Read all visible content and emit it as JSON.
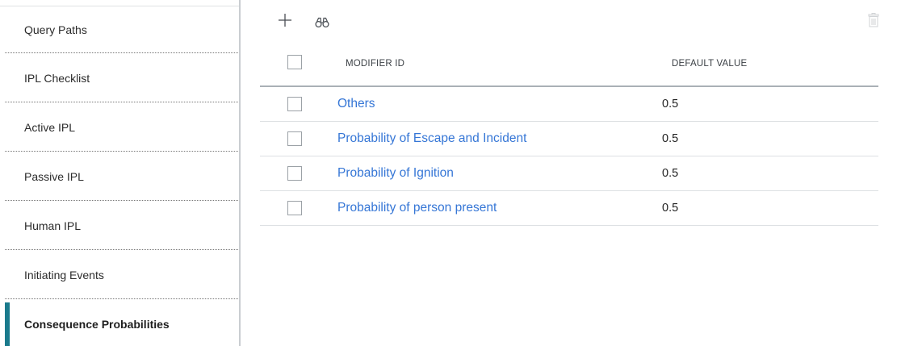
{
  "sidebar": {
    "items": [
      {
        "label": "Query Paths",
        "active": false
      },
      {
        "label": "IPL Checklist",
        "active": false
      },
      {
        "label": "Active IPL",
        "active": false
      },
      {
        "label": "Passive IPL",
        "active": false
      },
      {
        "label": "Human IPL",
        "active": false
      },
      {
        "label": "Initiating Events",
        "active": false
      },
      {
        "label": "Consequence Probabilities",
        "active": true
      }
    ],
    "accent_color": "#1a7a8c"
  },
  "toolbar": {
    "add_icon": "plus-icon",
    "find_icon": "binoculars-icon",
    "delete_icon": "trash-icon"
  },
  "grid": {
    "columns": [
      "MODIFIER ID",
      "DEFAULT VALUE"
    ],
    "rows": [
      {
        "modifier_id": "Others",
        "default_value": "0.5"
      },
      {
        "modifier_id": "Probability of Escape and Incident",
        "default_value": "0.5"
      },
      {
        "modifier_id": "Probability of Ignition",
        "default_value": "0.5"
      },
      {
        "modifier_id": "Probability of person present",
        "default_value": "0.5"
      }
    ],
    "link_color": "#3576d6"
  }
}
